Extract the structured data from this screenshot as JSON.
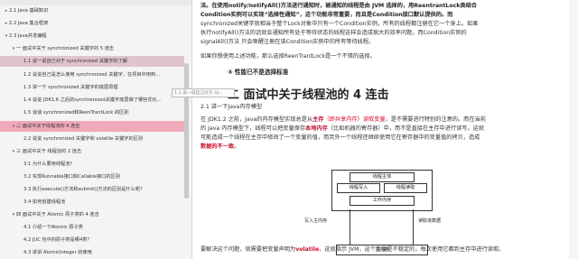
{
  "sidebar": {
    "items": [
      {
        "indent": 0,
        "expander": "▸",
        "label": "2.1 Java 基础知识",
        "state": ""
      },
      {
        "indent": 0,
        "expander": "▸",
        "label": "2.2 Java 集合框架",
        "state": ""
      },
      {
        "indent": 0,
        "expander": "▾",
        "label": "2.3 Java并发编程",
        "state": ""
      },
      {
        "indent": 1,
        "expander": "▾",
        "label": "一 面试中关于 synchronized 关键字的 5 连击",
        "state": ""
      },
      {
        "indent": 2,
        "expander": "",
        "label": "1.1 说一说自己对于 synchronized 关键字的了解",
        "state": "sel"
      },
      {
        "indent": 2,
        "expander": "",
        "label": "1.2 说说自己是怎么使用 synchronized 关键字，在项目中用到...",
        "state": ""
      },
      {
        "indent": 2,
        "expander": "",
        "label": "1.3 讲一下 synchronized 关键字的底层原理",
        "state": ""
      },
      {
        "indent": 2,
        "expander": "",
        "label": "1.4 说说 JDK1.6 之后的synchronized关键字底层做了哪些优化...",
        "state": ""
      },
      {
        "indent": 2,
        "expander": "",
        "label": "1.5 谈谈 synchronized和ReenTrantLock 的区别",
        "state": ""
      },
      {
        "indent": 1,
        "expander": "▾",
        "label": "二 面试中关于线程池的 4 连击",
        "state": "hl"
      },
      {
        "indent": 2,
        "expander": "",
        "label": "2.2 说说 synchronized 关键字和 volatile 关键字的区别",
        "state": ""
      },
      {
        "indent": 1,
        "expander": "▾",
        "label": "三 面试中关于 线程池的 2 连击",
        "state": ""
      },
      {
        "indent": 2,
        "expander": "",
        "label": "3.1 为什么要用线程池？",
        "state": ""
      },
      {
        "indent": 2,
        "expander": "",
        "label": "3.2 实现Runnable接口和Callable接口的区别",
        "state": ""
      },
      {
        "indent": 2,
        "expander": "",
        "label": "3.3 执行execute()方法和submit()方法的区别是什么呢？",
        "state": ""
      },
      {
        "indent": 2,
        "expander": "",
        "label": "3.4 如何创建线程池",
        "state": ""
      },
      {
        "indent": 1,
        "expander": "▾",
        "label": "四 面试中关于 Atomic 原子类的 4 连击",
        "state": ""
      },
      {
        "indent": 2,
        "expander": "",
        "label": "4.1 介绍一下Atomic 原子类",
        "state": ""
      },
      {
        "indent": 2,
        "expander": "",
        "label": "4.2 JUC 包中的原子类是哪4类？",
        "state": ""
      },
      {
        "indent": 2,
        "expander": "",
        "label": "4.3 讲讲 AtomicInteger 的使用",
        "state": ""
      }
    ],
    "tooltip": "1.1 说一说自己对于 sy..."
  },
  "content": {
    "p1_l1_a": "法。",
    "p1_l1_b": "在使用notify/notifyAll()方法进行通知时，被通知的线程是由 JVM 选择的，用ReentrantLock类结合",
    "p1_l2": "Condition实例可以实现“选择性通知”，这个功能非常重要，而且是Condition接口默认提供的。而",
    "p1_l3": "synchronized关键字就相当于整个Lock对象中只有一个Condition实例，所有的线程都注册在它一个身上。如果",
    "p1_l4": "执行notifyAll()方法的话就会通知所有处于等待状态的线程这样会造成很大的效率问题，而Condition实例的",
    "p1_l5": "signalAll()方法 只会唤醒注册在该Condition实例中的所有等待线程。",
    "p2": "如果你想使用上述功能，那么选择ReenTrantLock是一个不错的选择。",
    "h3": "④ 性能已不是选择标准",
    "h2": "二 面试中关于线程池的 4 连击",
    "sub": "2.1 讲一下Java内存模型",
    "p3_l1_a": "在 JDK1.2 之前，Java的内存模型实现总是从",
    "p3_l1_b": "主存",
    "p3_l1_c": "（即共享内存）",
    "p3_l1_d": "读取变量",
    "p3_l1_e": "，是不需要进行特别的注意的。而在当前",
    "p3_l2_a": "的 Java 内存模型下，线程可以把变量保存",
    "p3_l2_b": "本地内存",
    "p3_l2_c": "（比如机器的寄存器）中，而不是直接在主存中进行读写。这就",
    "p3_l3": "可能造成一个线程在主存中修改了一个变量的值，而另外一个线程还继续使用它在寄存器中的变量值的拷贝，造成",
    "p3_l4": "数据的不一致",
    "p3_l4_end": "。",
    "diagram": {
      "thread": "线程主体",
      "read_local": "线程写入",
      "write_local": "线程读取",
      "work_mem": "工作内存",
      "write_main": "写入主内存",
      "read_main": "读取该数据",
      "main_mem": "主内存"
    },
    "p4_a": "要解决这个问题，就需要把变量声明为",
    "p4_b": "volatile",
    "p4_c": "，这就指示 JVM，这个变量是不稳定的，每次使用它都到主存中进行读取。"
  },
  "colors": {
    "accent_red": "#c8102e",
    "highlight": "#f0a9b8",
    "selected": "#e0c4cd"
  }
}
